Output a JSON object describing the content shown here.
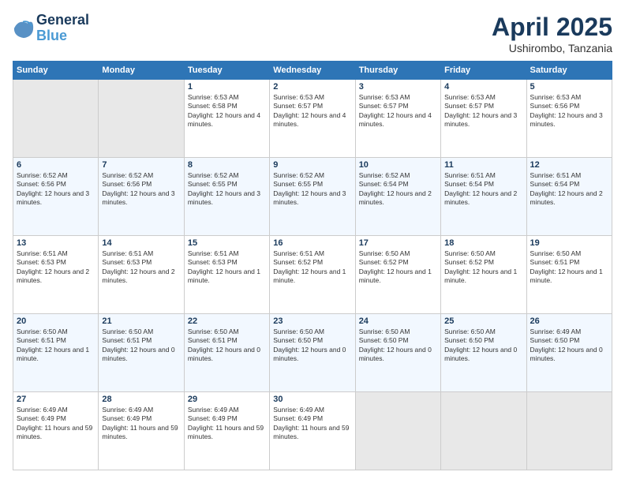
{
  "logo": {
    "line1": "General",
    "line2": "Blue"
  },
  "title": "April 2025",
  "location": "Ushirombo, Tanzania",
  "days_header": [
    "Sunday",
    "Monday",
    "Tuesday",
    "Wednesday",
    "Thursday",
    "Friday",
    "Saturday"
  ],
  "weeks": [
    [
      {
        "day": "",
        "sunrise": "",
        "sunset": "",
        "daylight": ""
      },
      {
        "day": "",
        "sunrise": "",
        "sunset": "",
        "daylight": ""
      },
      {
        "day": "1",
        "sunrise": "Sunrise: 6:53 AM",
        "sunset": "Sunset: 6:58 PM",
        "daylight": "Daylight: 12 hours and 4 minutes."
      },
      {
        "day": "2",
        "sunrise": "Sunrise: 6:53 AM",
        "sunset": "Sunset: 6:57 PM",
        "daylight": "Daylight: 12 hours and 4 minutes."
      },
      {
        "day": "3",
        "sunrise": "Sunrise: 6:53 AM",
        "sunset": "Sunset: 6:57 PM",
        "daylight": "Daylight: 12 hours and 4 minutes."
      },
      {
        "day": "4",
        "sunrise": "Sunrise: 6:53 AM",
        "sunset": "Sunset: 6:57 PM",
        "daylight": "Daylight: 12 hours and 3 minutes."
      },
      {
        "day": "5",
        "sunrise": "Sunrise: 6:53 AM",
        "sunset": "Sunset: 6:56 PM",
        "daylight": "Daylight: 12 hours and 3 minutes."
      }
    ],
    [
      {
        "day": "6",
        "sunrise": "Sunrise: 6:52 AM",
        "sunset": "Sunset: 6:56 PM",
        "daylight": "Daylight: 12 hours and 3 minutes."
      },
      {
        "day": "7",
        "sunrise": "Sunrise: 6:52 AM",
        "sunset": "Sunset: 6:56 PM",
        "daylight": "Daylight: 12 hours and 3 minutes."
      },
      {
        "day": "8",
        "sunrise": "Sunrise: 6:52 AM",
        "sunset": "Sunset: 6:55 PM",
        "daylight": "Daylight: 12 hours and 3 minutes."
      },
      {
        "day": "9",
        "sunrise": "Sunrise: 6:52 AM",
        "sunset": "Sunset: 6:55 PM",
        "daylight": "Daylight: 12 hours and 3 minutes."
      },
      {
        "day": "10",
        "sunrise": "Sunrise: 6:52 AM",
        "sunset": "Sunset: 6:54 PM",
        "daylight": "Daylight: 12 hours and 2 minutes."
      },
      {
        "day": "11",
        "sunrise": "Sunrise: 6:51 AM",
        "sunset": "Sunset: 6:54 PM",
        "daylight": "Daylight: 12 hours and 2 minutes."
      },
      {
        "day": "12",
        "sunrise": "Sunrise: 6:51 AM",
        "sunset": "Sunset: 6:54 PM",
        "daylight": "Daylight: 12 hours and 2 minutes."
      }
    ],
    [
      {
        "day": "13",
        "sunrise": "Sunrise: 6:51 AM",
        "sunset": "Sunset: 6:53 PM",
        "daylight": "Daylight: 12 hours and 2 minutes."
      },
      {
        "day": "14",
        "sunrise": "Sunrise: 6:51 AM",
        "sunset": "Sunset: 6:53 PM",
        "daylight": "Daylight: 12 hours and 2 minutes."
      },
      {
        "day": "15",
        "sunrise": "Sunrise: 6:51 AM",
        "sunset": "Sunset: 6:53 PM",
        "daylight": "Daylight: 12 hours and 1 minute."
      },
      {
        "day": "16",
        "sunrise": "Sunrise: 6:51 AM",
        "sunset": "Sunset: 6:52 PM",
        "daylight": "Daylight: 12 hours and 1 minute."
      },
      {
        "day": "17",
        "sunrise": "Sunrise: 6:50 AM",
        "sunset": "Sunset: 6:52 PM",
        "daylight": "Daylight: 12 hours and 1 minute."
      },
      {
        "day": "18",
        "sunrise": "Sunrise: 6:50 AM",
        "sunset": "Sunset: 6:52 PM",
        "daylight": "Daylight: 12 hours and 1 minute."
      },
      {
        "day": "19",
        "sunrise": "Sunrise: 6:50 AM",
        "sunset": "Sunset: 6:51 PM",
        "daylight": "Daylight: 12 hours and 1 minute."
      }
    ],
    [
      {
        "day": "20",
        "sunrise": "Sunrise: 6:50 AM",
        "sunset": "Sunset: 6:51 PM",
        "daylight": "Daylight: 12 hours and 1 minute."
      },
      {
        "day": "21",
        "sunrise": "Sunrise: 6:50 AM",
        "sunset": "Sunset: 6:51 PM",
        "daylight": "Daylight: 12 hours and 0 minutes."
      },
      {
        "day": "22",
        "sunrise": "Sunrise: 6:50 AM",
        "sunset": "Sunset: 6:51 PM",
        "daylight": "Daylight: 12 hours and 0 minutes."
      },
      {
        "day": "23",
        "sunrise": "Sunrise: 6:50 AM",
        "sunset": "Sunset: 6:50 PM",
        "daylight": "Daylight: 12 hours and 0 minutes."
      },
      {
        "day": "24",
        "sunrise": "Sunrise: 6:50 AM",
        "sunset": "Sunset: 6:50 PM",
        "daylight": "Daylight: 12 hours and 0 minutes."
      },
      {
        "day": "25",
        "sunrise": "Sunrise: 6:50 AM",
        "sunset": "Sunset: 6:50 PM",
        "daylight": "Daylight: 12 hours and 0 minutes."
      },
      {
        "day": "26",
        "sunrise": "Sunrise: 6:49 AM",
        "sunset": "Sunset: 6:50 PM",
        "daylight": "Daylight: 12 hours and 0 minutes."
      }
    ],
    [
      {
        "day": "27",
        "sunrise": "Sunrise: 6:49 AM",
        "sunset": "Sunset: 6:49 PM",
        "daylight": "Daylight: 11 hours and 59 minutes."
      },
      {
        "day": "28",
        "sunrise": "Sunrise: 6:49 AM",
        "sunset": "Sunset: 6:49 PM",
        "daylight": "Daylight: 11 hours and 59 minutes."
      },
      {
        "day": "29",
        "sunrise": "Sunrise: 6:49 AM",
        "sunset": "Sunset: 6:49 PM",
        "daylight": "Daylight: 11 hours and 59 minutes."
      },
      {
        "day": "30",
        "sunrise": "Sunrise: 6:49 AM",
        "sunset": "Sunset: 6:49 PM",
        "daylight": "Daylight: 11 hours and 59 minutes."
      },
      {
        "day": "",
        "sunrise": "",
        "sunset": "",
        "daylight": ""
      },
      {
        "day": "",
        "sunrise": "",
        "sunset": "",
        "daylight": ""
      },
      {
        "day": "",
        "sunrise": "",
        "sunset": "",
        "daylight": ""
      }
    ]
  ]
}
